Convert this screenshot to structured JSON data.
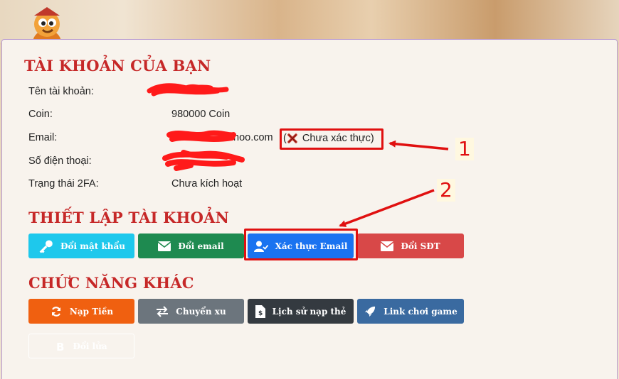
{
  "account": {
    "title": "TÀI KHOẢN CỦA BẠN",
    "rows": [
      {
        "label": "Tên tài khoản:",
        "value": ""
      },
      {
        "label": "Coin:",
        "value": "980000 Coin"
      },
      {
        "label": "Email:",
        "value": "hoo.com"
      },
      {
        "label": "Số điện thoại:",
        "value": ""
      },
      {
        "label": "Trạng thái 2FA:",
        "value": "Chưa kích hoạt"
      }
    ],
    "email_status": "(",
    "email_status_text": "Chưa xác thực)"
  },
  "settings": {
    "title": "THIẾT LẬP TÀI KHOẢN",
    "buttons": [
      {
        "label": "Đổi mật khẩu",
        "color": "#1ec8ec"
      },
      {
        "label": "Đổi email",
        "color": "#1e8a50"
      },
      {
        "label": "Xác thực Email",
        "color": "#1a73f0"
      },
      {
        "label": "Đổi SĐT",
        "color": "#d84848"
      }
    ]
  },
  "other": {
    "title": "CHỨC NĂNG KHÁC",
    "buttons": [
      {
        "label": "Nạp Tiền",
        "color": "#f06010"
      },
      {
        "label": "Chuyển xu",
        "color": "#6c757d"
      },
      {
        "label": "Lịch sử nạp thẻ",
        "color": "#343a40"
      },
      {
        "label": "Link chơi game",
        "color": "#3a6aa0"
      },
      {
        "label": "Đổi lửa",
        "color": "#ffffff"
      }
    ]
  },
  "annotations": {
    "marker_1": "1",
    "marker_2": "2",
    "color": "#e01010"
  }
}
